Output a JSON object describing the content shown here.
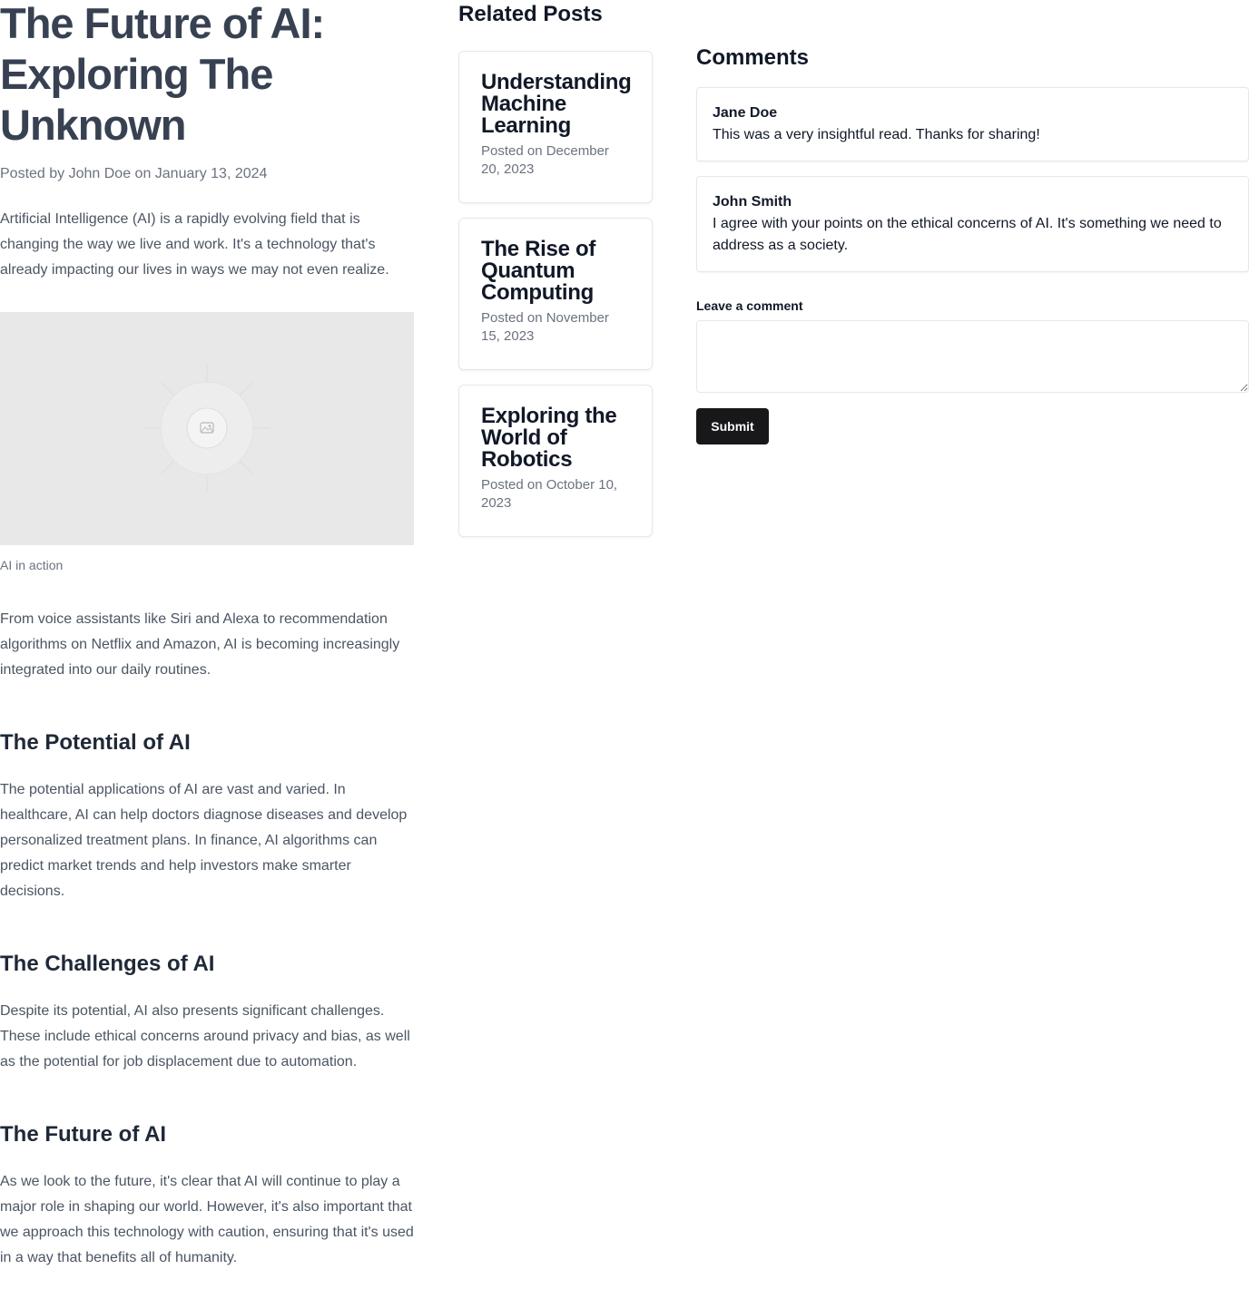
{
  "article": {
    "title": "The Future of AI: Exploring The Unknown",
    "meta": "Posted by John Doe on January 13, 2024",
    "intro": "Artificial Intelligence (AI) is a rapidly evolving field that is changing the way we live and work. It's a technology that's already impacting our lives in ways we may not even realize.",
    "image_icon": "image-placeholder-icon",
    "image_caption": "AI in action",
    "paragraph_2": "From voice assistants like Siri and Alexa to recommendation algorithms on Netflix and Amazon, AI is becoming increasingly integrated into our daily routines.",
    "sections": [
      {
        "heading": "The Potential of AI",
        "body": "The potential applications of AI are vast and varied. In healthcare, AI can help doctors diagnose diseases and develop personalized treatment plans. In finance, AI algorithms can predict market trends and help investors make smarter decisions."
      },
      {
        "heading": "The Challenges of AI",
        "body": "Despite its potential, AI also presents significant challenges. These include ethical concerns around privacy and bias, as well as the potential for job displacement due to automation."
      },
      {
        "heading": "The Future of AI",
        "body": "As we look to the future, it's clear that AI will continue to play a major role in shaping our world. However, it's also important that we approach this technology with caution, ensuring that it's used in a way that benefits all of humanity."
      }
    ]
  },
  "related": {
    "title": "Related Posts",
    "posts": [
      {
        "title": "Understanding Machine Learning",
        "date": "Posted on December 20, 2023"
      },
      {
        "title": "The Rise of Quantum Computing",
        "date": "Posted on November 15, 2023"
      },
      {
        "title": "Exploring the World of Robotics",
        "date": "Posted on October 10, 2023"
      }
    ]
  },
  "comments": {
    "title": "Comments",
    "items": [
      {
        "author": "Jane Doe",
        "text": "This was a very insightful read. Thanks for sharing!"
      },
      {
        "author": "John Smith",
        "text": "I agree with your points on the ethical concerns of AI. It's something we need to address as a society."
      }
    ],
    "form": {
      "label": "Leave a comment",
      "value": "",
      "submit_label": "Submit"
    }
  },
  "colors": {
    "heading": "#374151",
    "body_text": "#4b5563",
    "muted": "#6b7280",
    "button_bg": "#18181b",
    "border": "#e5e7eb",
    "image_bg": "#e8e8e8"
  }
}
